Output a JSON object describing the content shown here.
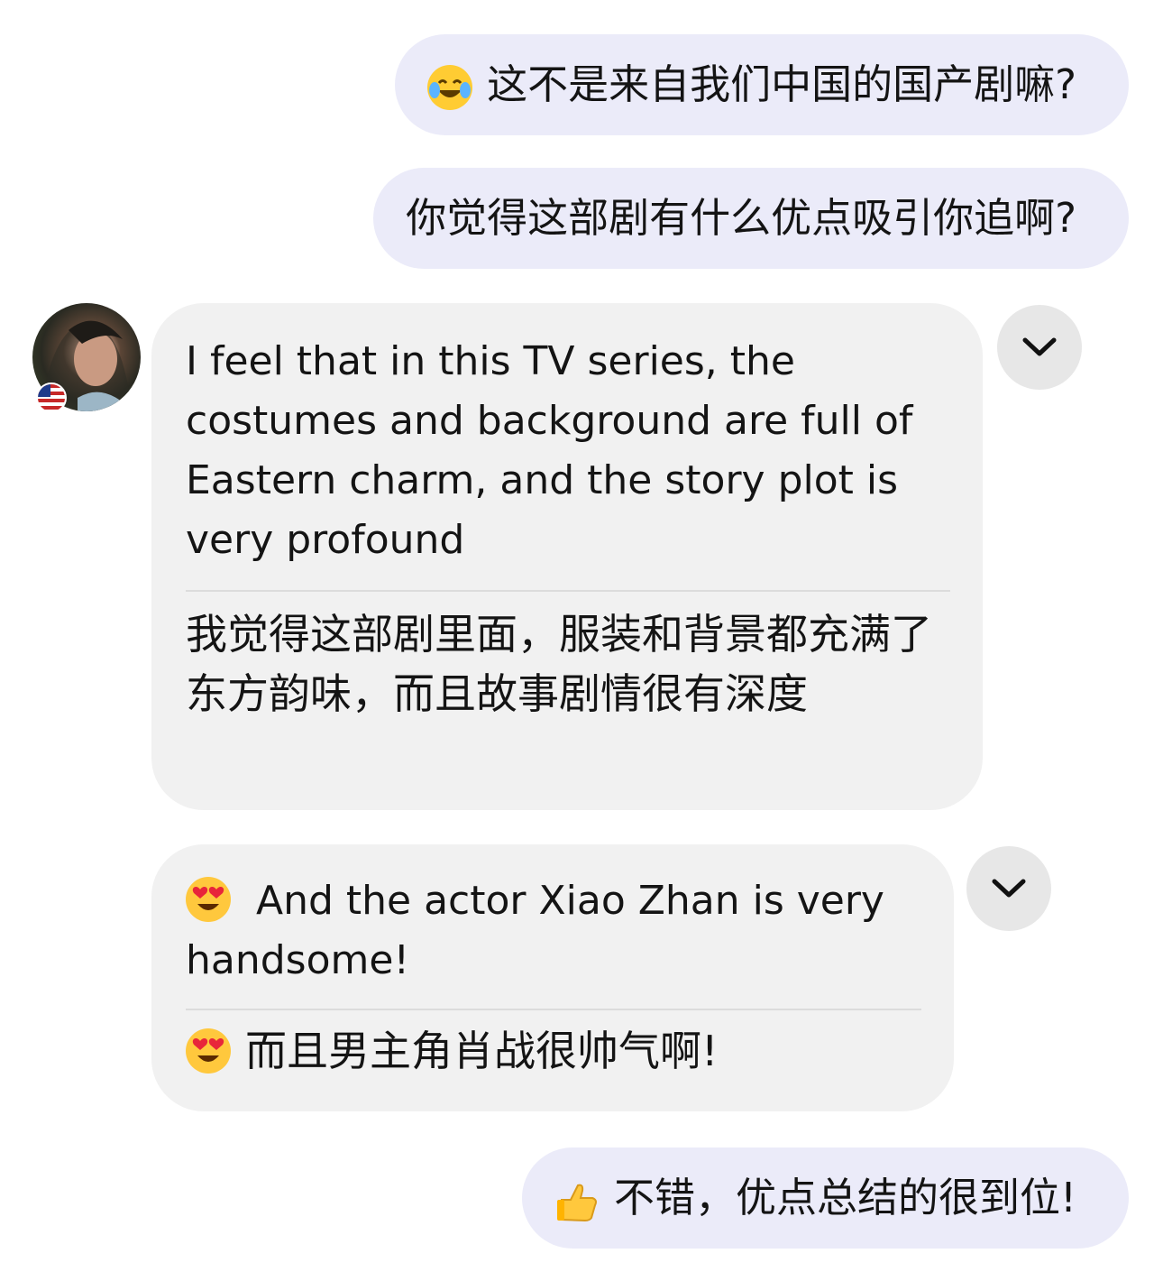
{
  "messages": {
    "sent1": {
      "emoji": "face-with-tears-of-joy-emoji",
      "text": "这不是来自我们中国的国产剧嘛?"
    },
    "sent2": {
      "text": "你觉得这部剧有什么优点吸引你追啊?"
    },
    "recv1": {
      "english": "I feel that in this TV series, the costumes and background are full of Eastern charm, and the story plot is very profound",
      "chinese": "我觉得这部剧里面，服装和背景都充满了东方韵味，而且故事剧情很有深度"
    },
    "recv2": {
      "emoji": "smiling-face-with-heart-eyes-emoji",
      "english": "And the actor Xiao Zhan is very handsome!",
      "chinese": "而且男主角肖战很帅气啊!"
    },
    "sent3": {
      "emoji": "thumbs-up-emoji",
      "text": "不错，优点总结的很到位!"
    }
  },
  "contact": {
    "avatar": "avatar",
    "flag": "us-flag-icon"
  },
  "icons": {
    "expand": "chevron-down-icon"
  },
  "colors": {
    "sent_bubble": "#ebebf9",
    "received_bubble": "#f1f1f1",
    "chevron_button": "#e7e7e7"
  }
}
